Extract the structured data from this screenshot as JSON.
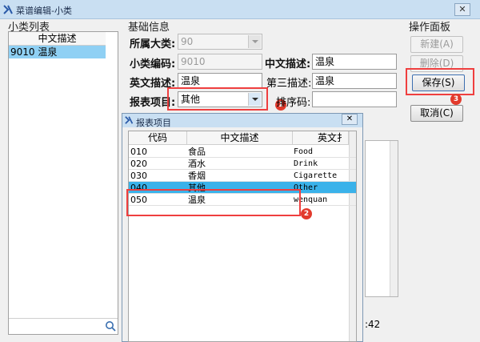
{
  "window": {
    "title": "菜谱编辑-小类",
    "close_label": "✕"
  },
  "left": {
    "section_label": "小类列表",
    "column_header": "中文描述",
    "selected_row": "9010 温泉"
  },
  "basic": {
    "section_label": "基础信息",
    "category_label": "所属大类:",
    "category_value": "90",
    "code_label": "小类编码:",
    "code_value": "9010",
    "cn_desc_label": "中文描述:",
    "cn_desc_value": "温泉",
    "en_desc_label": "英文描述:",
    "en_desc_value": "温泉",
    "third_desc_label": "第三描述:",
    "third_desc_value": "温泉",
    "report_label": "报表项目:",
    "report_value": "其他",
    "sort_label": "排序码:",
    "sort_value": "",
    "bg_fragment": ":42"
  },
  "ops": {
    "section_label": "操作面板",
    "new_label": "新建(A)",
    "delete_label": "删除(D)",
    "save_label": "保存(S)",
    "cancel_label": "取消(C)"
  },
  "badges": {
    "b1": "1",
    "b2": "2",
    "b3": "3"
  },
  "popup": {
    "title": "报表项目",
    "close_label": "✕",
    "columns": [
      "代码",
      "中文描述",
      "英文扌"
    ],
    "rows": [
      {
        "code": "010",
        "cn": "食品",
        "en": "Food"
      },
      {
        "code": "020",
        "cn": "酒水",
        "en": "Drink"
      },
      {
        "code": "030",
        "cn": "香烟",
        "en": "Cigarette"
      },
      {
        "code": "040",
        "cn": "其他",
        "en": "Other"
      },
      {
        "code": "050",
        "cn": "温泉",
        "en": "wenquan"
      }
    ]
  },
  "colors": {
    "highlight": "#ef3f3f",
    "selection": "#3ab2ea",
    "list_selection": "#8fd0f4"
  }
}
